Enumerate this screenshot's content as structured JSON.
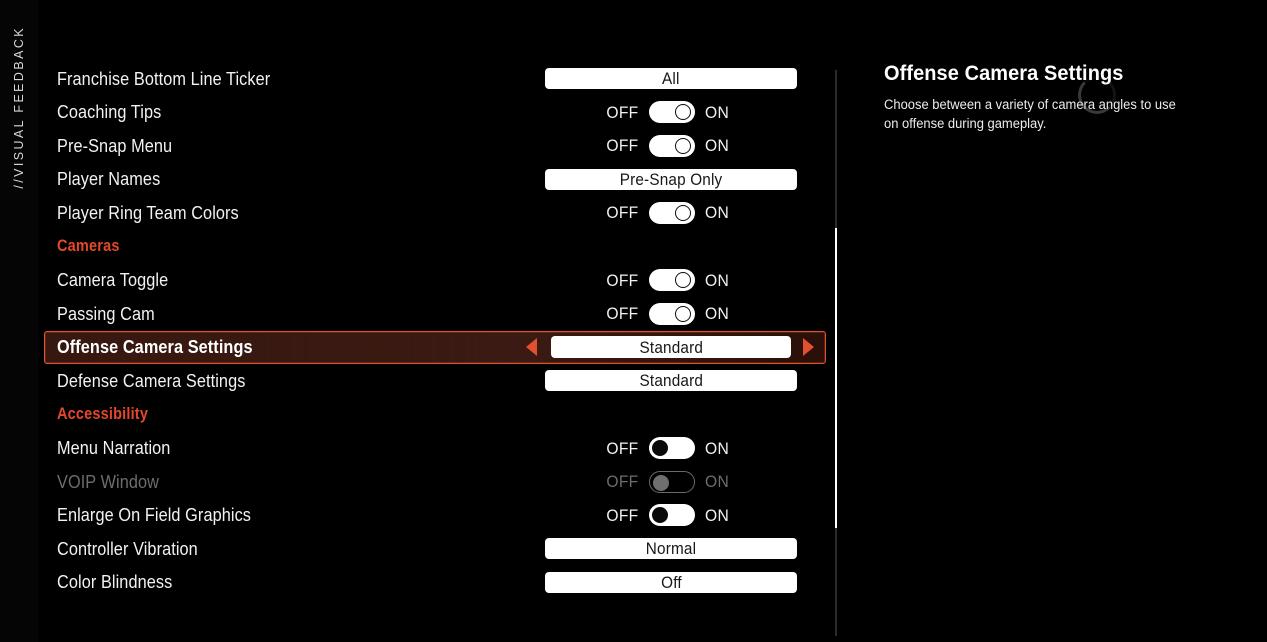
{
  "sidebar": {
    "tab_label": "//VISUAL FEEDBACK"
  },
  "colors": {
    "accent": "#e4472b",
    "selected_border": "#e2502f",
    "background": "#000000",
    "text": "#f2f2f2",
    "disabled_text": "#6d6d6d"
  },
  "settings": {
    "rows": [
      {
        "label": "Franchise Bottom Line Ticker",
        "type": "dropdown",
        "value": "All",
        "selected": false,
        "disabled": false
      },
      {
        "label": "Coaching Tips",
        "type": "toggle",
        "value": "ON",
        "off_label": "OFF",
        "on_label": "ON",
        "selected": false,
        "disabled": false
      },
      {
        "label": "Pre-Snap Menu",
        "type": "toggle",
        "value": "ON",
        "off_label": "OFF",
        "on_label": "ON",
        "selected": false,
        "disabled": false
      },
      {
        "label": "Player Names",
        "type": "dropdown",
        "value": "Pre-Snap Only",
        "selected": false,
        "disabled": false
      },
      {
        "label": "Player Ring Team Colors",
        "type": "toggle",
        "value": "ON",
        "off_label": "OFF",
        "on_label": "ON",
        "selected": false,
        "disabled": false
      },
      {
        "label": "Cameras",
        "type": "group",
        "selected": false,
        "disabled": false
      },
      {
        "label": "Camera Toggle",
        "type": "toggle",
        "value": "ON",
        "off_label": "OFF",
        "on_label": "ON",
        "selected": false,
        "disabled": false
      },
      {
        "label": "Passing Cam",
        "type": "toggle",
        "value": "ON",
        "off_label": "OFF",
        "on_label": "ON",
        "selected": false,
        "disabled": false
      },
      {
        "label": "Offense Camera Settings",
        "type": "dropdown",
        "value": "Standard",
        "selected": true,
        "disabled": false
      },
      {
        "label": "Defense Camera Settings",
        "type": "dropdown",
        "value": "Standard",
        "selected": false,
        "disabled": false
      },
      {
        "label": "Accessibility",
        "type": "group",
        "selected": false,
        "disabled": false
      },
      {
        "label": "Menu Narration",
        "type": "toggle",
        "value": "OFF",
        "off_label": "OFF",
        "on_label": "ON",
        "selected": false,
        "disabled": false
      },
      {
        "label": "VOIP Window",
        "type": "toggle",
        "value": "OFF",
        "off_label": "OFF",
        "on_label": "ON",
        "selected": false,
        "disabled": true
      },
      {
        "label": "Enlarge On Field Graphics",
        "type": "toggle",
        "value": "OFF",
        "off_label": "OFF",
        "on_label": "ON",
        "selected": false,
        "disabled": false
      },
      {
        "label": "Controller Vibration",
        "type": "dropdown",
        "value": "Normal",
        "selected": false,
        "disabled": false
      },
      {
        "label": "Color Blindness",
        "type": "dropdown",
        "value": "Off",
        "selected": false,
        "disabled": false
      }
    ]
  },
  "info_panel": {
    "title": "Offense Camera Settings",
    "description": "Choose between a variety of camera angles to use on offense during gameplay."
  },
  "scrollbar": {
    "thumb_top_pct": 28,
    "thumb_height_pct": 53
  }
}
